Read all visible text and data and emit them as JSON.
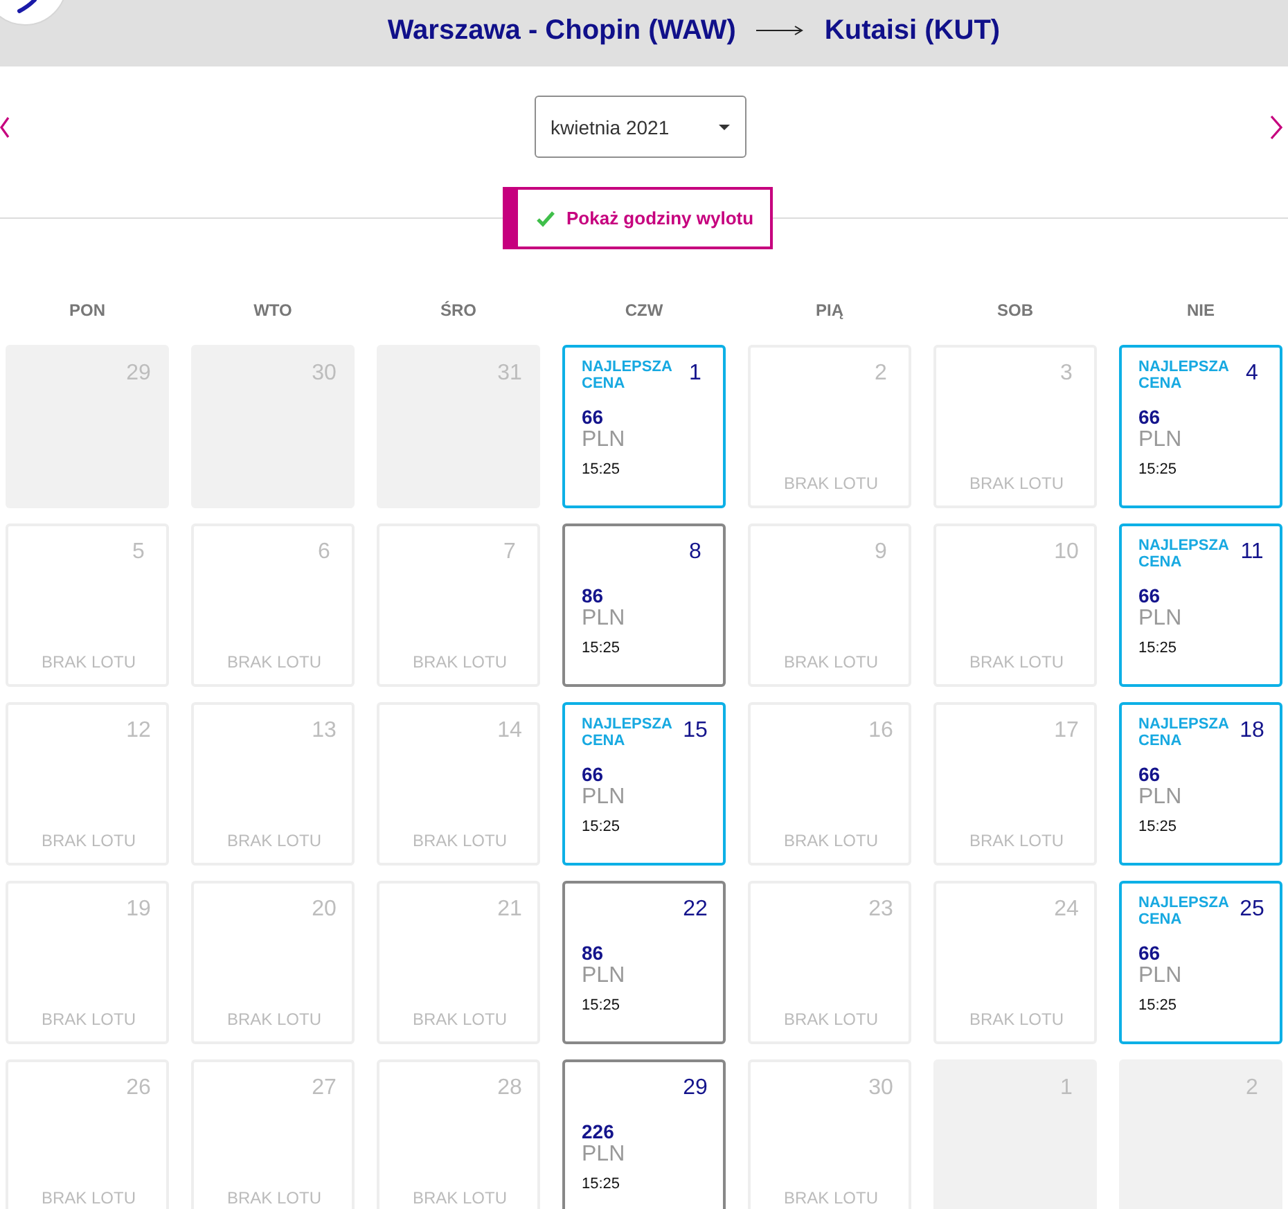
{
  "header": {
    "origin": "Warszawa - Chopin (WAW)",
    "destination": "Kutaisi (KUT)"
  },
  "month_select": {
    "value": "kwietnia 2021"
  },
  "departure_times_toggle": {
    "label": "Pokaż godziny wylotu",
    "checked": true
  },
  "weekdays": [
    "PON",
    "WTO",
    "ŚRO",
    "CZW",
    "PIĄ",
    "SOB",
    "NIE"
  ],
  "weeks": [
    [
      {
        "day": "29",
        "kind": "outside"
      },
      {
        "day": "30",
        "kind": "outside"
      },
      {
        "day": "31",
        "kind": "outside"
      },
      {
        "day": "1",
        "kind": "flight",
        "best": true,
        "badge": "NAJLEPSZA CENA",
        "price": "66",
        "currency": "PLN",
        "time": "15:25"
      },
      {
        "day": "2",
        "kind": "no_flight",
        "note": "BRAK LOTU"
      },
      {
        "day": "3",
        "kind": "no_flight",
        "note": "BRAK LOTU"
      },
      {
        "day": "4",
        "kind": "flight",
        "best": true,
        "badge": "NAJLEPSZA CENA",
        "price": "66",
        "currency": "PLN",
        "time": "15:25"
      }
    ],
    [
      {
        "day": "5",
        "kind": "no_flight",
        "note": "BRAK LOTU"
      },
      {
        "day": "6",
        "kind": "no_flight",
        "note": "BRAK LOTU"
      },
      {
        "day": "7",
        "kind": "no_flight",
        "note": "BRAK LOTU"
      },
      {
        "day": "8",
        "kind": "flight",
        "best": false,
        "price": "86",
        "currency": "PLN",
        "time": "15:25"
      },
      {
        "day": "9",
        "kind": "no_flight",
        "note": "BRAK LOTU"
      },
      {
        "day": "10",
        "kind": "no_flight",
        "note": "BRAK LOTU"
      },
      {
        "day": "11",
        "kind": "flight",
        "best": true,
        "badge": "NAJLEPSZA CENA",
        "price": "66",
        "currency": "PLN",
        "time": "15:25"
      }
    ],
    [
      {
        "day": "12",
        "kind": "no_flight",
        "note": "BRAK LOTU"
      },
      {
        "day": "13",
        "kind": "no_flight",
        "note": "BRAK LOTU"
      },
      {
        "day": "14",
        "kind": "no_flight",
        "note": "BRAK LOTU"
      },
      {
        "day": "15",
        "kind": "flight",
        "best": true,
        "badge": "NAJLEPSZA CENA",
        "price": "66",
        "currency": "PLN",
        "time": "15:25"
      },
      {
        "day": "16",
        "kind": "no_flight",
        "note": "BRAK LOTU"
      },
      {
        "day": "17",
        "kind": "no_flight",
        "note": "BRAK LOTU"
      },
      {
        "day": "18",
        "kind": "flight",
        "best": true,
        "badge": "NAJLEPSZA CENA",
        "price": "66",
        "currency": "PLN",
        "time": "15:25"
      }
    ],
    [
      {
        "day": "19",
        "kind": "no_flight",
        "note": "BRAK LOTU"
      },
      {
        "day": "20",
        "kind": "no_flight",
        "note": "BRAK LOTU"
      },
      {
        "day": "21",
        "kind": "no_flight",
        "note": "BRAK LOTU"
      },
      {
        "day": "22",
        "kind": "flight",
        "best": false,
        "price": "86",
        "currency": "PLN",
        "time": "15:25"
      },
      {
        "day": "23",
        "kind": "no_flight",
        "note": "BRAK LOTU"
      },
      {
        "day": "24",
        "kind": "no_flight",
        "note": "BRAK LOTU"
      },
      {
        "day": "25",
        "kind": "flight",
        "best": true,
        "badge": "NAJLEPSZA CENA",
        "price": "66",
        "currency": "PLN",
        "time": "15:25"
      }
    ],
    [
      {
        "day": "26",
        "kind": "no_flight",
        "note": "BRAK LOTU"
      },
      {
        "day": "27",
        "kind": "no_flight",
        "note": "BRAK LOTU"
      },
      {
        "day": "28",
        "kind": "no_flight",
        "note": "BRAK LOTU"
      },
      {
        "day": "29",
        "kind": "flight",
        "best": false,
        "price": "226",
        "currency": "PLN",
        "time": "15:25"
      },
      {
        "day": "30",
        "kind": "no_flight",
        "note": "BRAK LOTU"
      },
      {
        "day": "1",
        "kind": "outside"
      },
      {
        "day": "2",
        "kind": "outside"
      }
    ]
  ]
}
